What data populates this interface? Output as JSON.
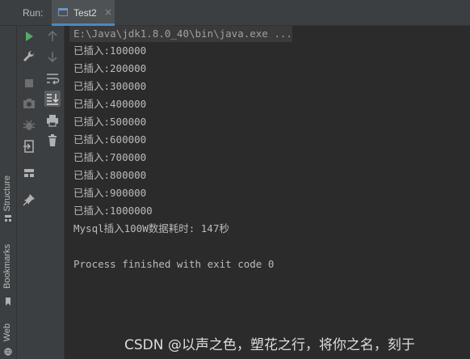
{
  "toolbar": {
    "run_label": "Run:"
  },
  "tab": {
    "label": "Test2",
    "close": "×"
  },
  "sidebar": {
    "structure": "Structure",
    "bookmarks": "Bookmarks",
    "web": "Web"
  },
  "console": {
    "command": "E:\\Java\\jdk1.8.0_40\\bin\\java.exe ...",
    "lines": [
      "已插入:100000",
      "已插入:200000",
      "已插入:300000",
      "已插入:400000",
      "已插入:500000",
      "已插入:600000",
      "已插入:700000",
      "已插入:800000",
      "已插入:900000",
      "已插入:1000000",
      "Mysql插入100W数据耗时: 147秒",
      "",
      "Process finished with exit code 0"
    ]
  },
  "watermark": "CSDN @以声之色，塑花之行，将你之名，刻于",
  "icons": {
    "col1": [
      "run-icon",
      "wrench-icon",
      "stop-icon",
      "camera-icon",
      "debug-icon",
      "exit-icon",
      "layout-icon",
      "pin-icon"
    ],
    "col2": [
      "arrow-up-icon",
      "arrow-down-icon",
      "soft-wrap-icon",
      "scroll-to-end-icon",
      "print-icon",
      "trash-icon"
    ]
  },
  "colors": {
    "accent": "#4a88c7",
    "run_green": "#59a869",
    "background": "#2b2b2b",
    "panel": "#3c3f41"
  }
}
